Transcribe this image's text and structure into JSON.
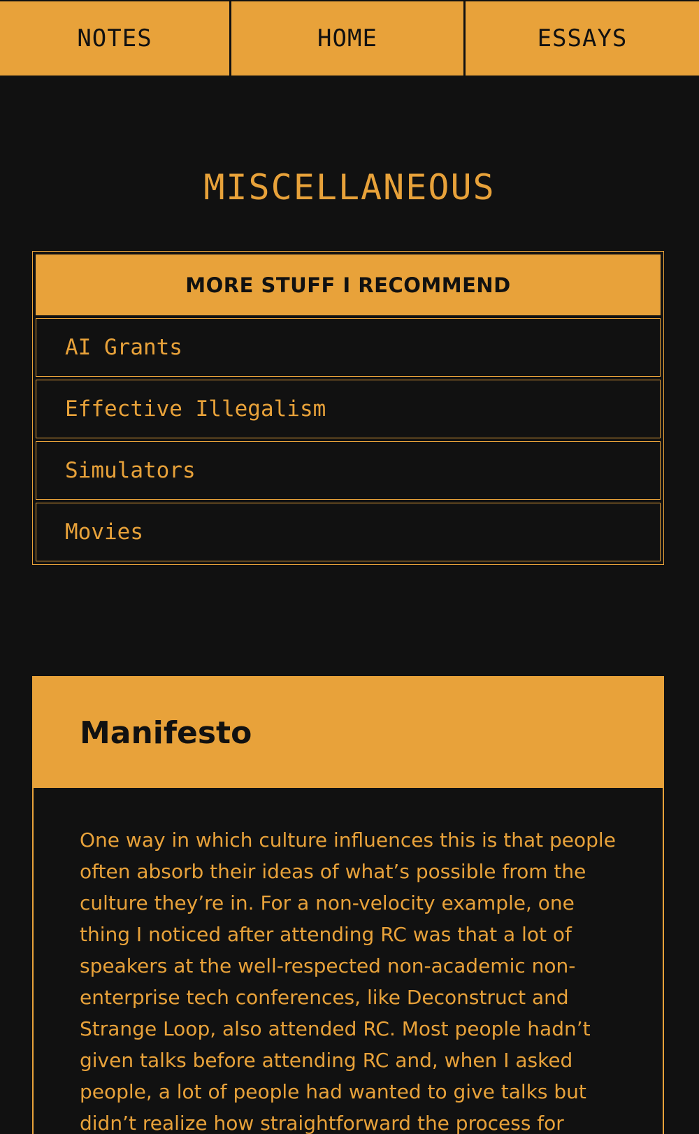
{
  "nav": {
    "tabs": [
      {
        "label": "NOTES"
      },
      {
        "label": "HOME"
      },
      {
        "label": "ESSAYS"
      }
    ]
  },
  "page": {
    "heading": "MISCELLANEOUS"
  },
  "recommendations": {
    "header": "MORE STUFF I RECOMMEND",
    "items": [
      {
        "label": "AI Grants"
      },
      {
        "label": "Effective Illegalism"
      },
      {
        "label": "Simulators"
      },
      {
        "label": "Movies"
      }
    ]
  },
  "manifesto": {
    "title": "Manifesto",
    "body": "One way in which culture influences this is that people often absorb their ideas of what’s possible from the culture they’re in. For a non-velocity example, one thing I noticed after attending RC was that a lot of speakers at the well-respected non-academic non-enterprise tech conferences, like Deconstruct and Strange Loop, also attended RC. Most people hadn’t given talks before attending RC and, when I asked people, a lot of people had wanted to give talks but didn’t realize how straightforward the process for"
  },
  "colors": {
    "accent": "#E8A23A",
    "background": "#111111"
  }
}
